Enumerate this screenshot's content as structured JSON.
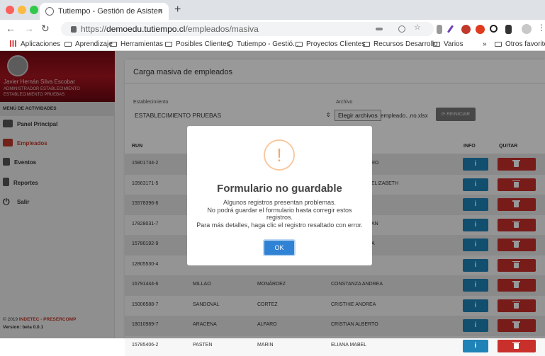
{
  "browser": {
    "tab_title": "Tutiempo - Gestión de Asisten",
    "tab_close": "×",
    "new_tab": "+",
    "url_prefix": "https://",
    "url_domain": "demoedu.tutiempo.cl",
    "url_path": "/empleados/masiva",
    "bookmarks": [
      "Aplicaciones",
      "Aprendizaje",
      "Herramientas",
      "Posibles Clientes",
      "Tutiempo - Gestió...",
      "Proyectos Clientes",
      "Recursos Desarrollo",
      "Varios",
      "»",
      "Otros favoritos"
    ]
  },
  "sidebar": {
    "user_name": "Javier Hernán Silva Escobar",
    "user_role": "Administrador Establecimiento",
    "user_establishment": "ESTABLECIMIENTO PRUEBAS",
    "menu_header": "MENÚ DE ACTIVIDADES",
    "items": [
      {
        "label": "Panel Principal",
        "icon": "dashboard-icon"
      },
      {
        "label": "Empleados",
        "icon": "users-icon"
      },
      {
        "label": "Eventos",
        "icon": "calendar-icon"
      },
      {
        "label": "Reportes",
        "icon": "document-icon"
      },
      {
        "label": "Salir",
        "icon": "power-icon"
      }
    ],
    "footer_year": "© 2019",
    "footer_company": "INDETEC - PRESERCOMP",
    "footer_version": "Version: beta 0.0.1"
  },
  "main": {
    "title": "Carga masiva de empleados",
    "establishment_label": "Establecimiento",
    "establishment_value": "ESTABLECIMIENTO PRUEBAS",
    "file_label": "Archivo",
    "file_button": "Elegir archivos",
    "file_name": "empleado...no.xlsx",
    "reset_button": "REINICIAR",
    "columns": {
      "run": "RUN",
      "info": "INFO",
      "delete": "QUITAR"
    },
    "rows": [
      {
        "run": "15801734-2",
        "c2": "",
        "c3": "",
        "c4": "RO"
      },
      {
        "run": "10563171-5",
        "c2": "",
        "c3": "",
        "c4": "ELIZABETH"
      },
      {
        "run": "15578396-6",
        "c2": "",
        "c3": "",
        "c4": ""
      },
      {
        "run": "17828031-7",
        "c2": "",
        "c3": "",
        "c4": "AN"
      },
      {
        "run": "15780192-9",
        "c2": "",
        "c3": "",
        "c4": "A"
      },
      {
        "run": "12805530-4",
        "c2": "",
        "c3": "",
        "c4": ""
      },
      {
        "run": "16791444-6",
        "c2": "MILLAO",
        "c3": "MONÁRDEZ",
        "c4": "CONSTANZA ANDREA"
      },
      {
        "run": "15006588-7",
        "c2": "SANDOVAL",
        "c3": "CORTEZ",
        "c4": "CRISTHIE ANDREA"
      },
      {
        "run": "18010989-7",
        "c2": "ARACENA",
        "c3": "ALFARO",
        "c4": "CRISTIAN ALBERTO"
      },
      {
        "run": "15785406-2",
        "c2": "PASTEN",
        "c3": "MARIN",
        "c4": "ELIANA MABEL"
      }
    ],
    "info_glyph": "i"
  },
  "modal": {
    "icon_glyph": "!",
    "title": "Formulario no guardable",
    "line1": "Algunos registros presentan problemas.",
    "line2": "No podrá guardar el formulario hasta corregir estos registros.",
    "line3": "Para más detalles, haga clic el registro resaltado con error.",
    "ok": "OK"
  },
  "colors": {
    "accent_red": "#c0392b",
    "info_blue": "#1f83b7",
    "delete_red": "#c9302c",
    "ok_blue": "#3083d4"
  }
}
